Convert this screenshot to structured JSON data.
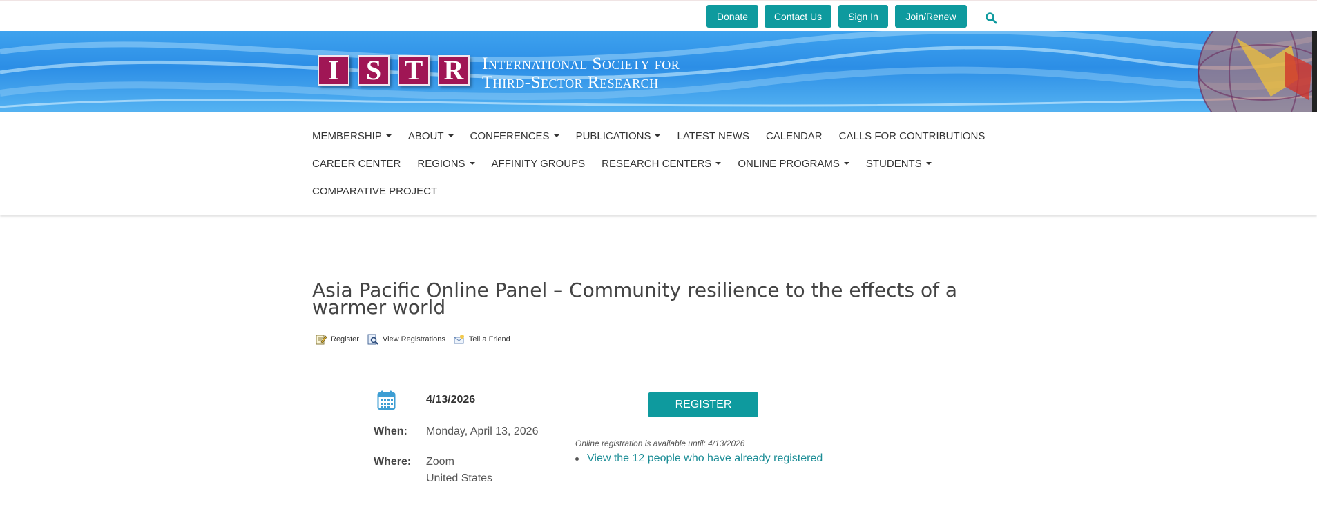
{
  "topbar": {
    "buttons": [
      {
        "label": "Donate"
      },
      {
        "label": "Contact Us"
      },
      {
        "label": "Sign In"
      },
      {
        "label": "Join/Renew"
      }
    ],
    "search_icon": "search-icon"
  },
  "banner": {
    "logo_letters": [
      "I",
      "S",
      "T",
      "R"
    ],
    "name_line1": "International Society for",
    "name_line2": "Third-Sector Research"
  },
  "nav": {
    "row1": [
      {
        "label": "MEMBERSHIP",
        "dropdown": true
      },
      {
        "label": "ABOUT",
        "dropdown": true
      },
      {
        "label": "CONFERENCES",
        "dropdown": true
      },
      {
        "label": "PUBLICATIONS",
        "dropdown": true
      },
      {
        "label": "LATEST NEWS",
        "dropdown": false
      },
      {
        "label": "CALENDAR",
        "dropdown": false
      },
      {
        "label": "CALLS FOR CONTRIBUTIONS",
        "dropdown": false
      }
    ],
    "row2": [
      {
        "label": "CAREER CENTER",
        "dropdown": false
      },
      {
        "label": "REGIONS",
        "dropdown": true
      },
      {
        "label": "AFFINITY GROUPS",
        "dropdown": false
      },
      {
        "label": "RESEARCH CENTERS",
        "dropdown": true
      },
      {
        "label": "ONLINE PROGRAMS",
        "dropdown": true
      },
      {
        "label": "STUDENTS",
        "dropdown": true
      }
    ],
    "row3": [
      {
        "label": "COMPARATIVE PROJECT",
        "dropdown": false
      }
    ]
  },
  "event": {
    "title": "Asia Pacific Online Panel – Community resilience to the effects of a warmer world",
    "actions": {
      "register": "Register",
      "view_registrations": "View Registrations",
      "tell_friend": "Tell a Friend"
    },
    "date": "4/13/2026",
    "when_label": "When:",
    "when_value": "Monday, April 13, 2026",
    "where_label": "Where:",
    "where_line1": "Zoom",
    "where_line2": "United States",
    "register_button": "REGISTER",
    "online_note": "Online registration is available until: 4/13/2026",
    "registered_link": "View the 12 people who have already registered"
  },
  "colors": {
    "teal": "#0e9a9e",
    "logo_magenta": "#a01655",
    "banner_blue": "#2c8ee6",
    "link": "#1a8c95"
  }
}
